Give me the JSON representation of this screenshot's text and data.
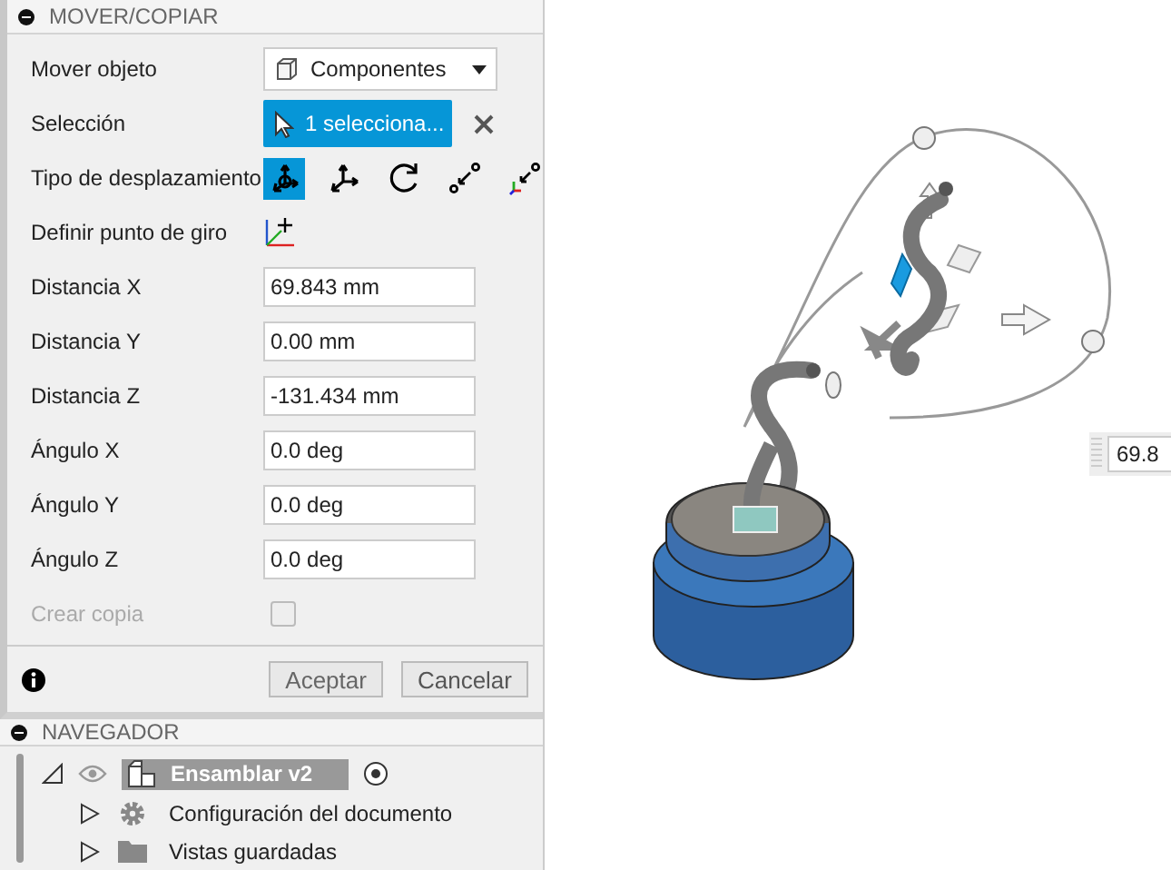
{
  "move_panel": {
    "title": "MOVER/COPIAR",
    "rows": [
      {
        "kind": "dropdown",
        "label": "Mover objeto",
        "value": "Componentes"
      },
      {
        "kind": "selection",
        "label": "Selección",
        "value": "1 selecciona..."
      },
      {
        "kind": "tools",
        "label": "Tipo de desplazamiento",
        "tools": [
          {
            "kind": "free",
            "selected": true
          },
          {
            "kind": "translate",
            "selected": false
          },
          {
            "kind": "rotate",
            "selected": false
          },
          {
            "kind": "point-to-point",
            "selected": false
          },
          {
            "kind": "point-to-position",
            "selected": false
          }
        ]
      },
      {
        "kind": "pivot",
        "label": "Definir punto de giro"
      },
      {
        "kind": "input",
        "label": "Distancia X",
        "value": "69.843 mm"
      },
      {
        "kind": "input",
        "label": "Distancia Y",
        "value": "0.00 mm"
      },
      {
        "kind": "input",
        "label": "Distancia Z",
        "value": "-131.434 mm"
      },
      {
        "kind": "input",
        "label": "Ángulo X",
        "value": "0.0 deg"
      },
      {
        "kind": "input",
        "label": "Ángulo Y",
        "value": "0.0 deg"
      },
      {
        "kind": "input",
        "label": "Ángulo Z",
        "value": "0.0 deg"
      },
      {
        "kind": "checkbox",
        "label": "Crear copia",
        "checked": false,
        "disabled": true
      }
    ],
    "buttons": [
      "Aceptar",
      "Cancelar"
    ]
  },
  "navigator": {
    "title": "NAVEGADOR",
    "tree": [
      {
        "label": "Ensamblar v2",
        "selected": true,
        "expanded": true,
        "children": [
          {
            "label": "Configuración del documento",
            "kind": "settings",
            "selected": false,
            "expanded": false
          },
          {
            "label": "Vistas guardadas",
            "kind": "folder",
            "selected": false,
            "expanded": false
          }
        ]
      }
    ]
  },
  "viewport": {
    "distance_input": "69.8"
  }
}
